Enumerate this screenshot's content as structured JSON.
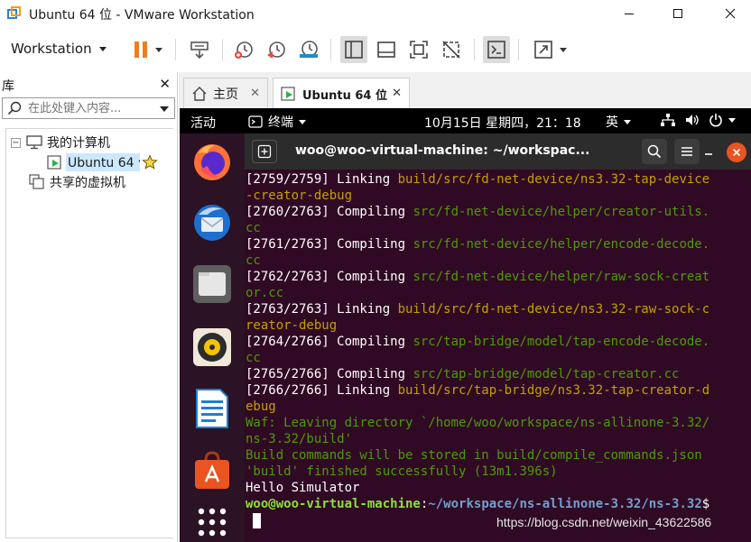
{
  "window": {
    "title": "Ubuntu 64 位 - VMware Workstation"
  },
  "toolbar": {
    "workstation_menu": "Workstation",
    "icons": [
      "pause-icon",
      "send-keys-icon",
      "snapshot-icon",
      "revert-snapshot-icon",
      "snapshot-manager-icon",
      "library-view-icon",
      "console-view-icon",
      "fullscreen-icon",
      "unity-icon",
      "terminal-view-icon",
      "stretch-icon"
    ]
  },
  "library": {
    "title": "库",
    "search_placeholder": "在此处键入内容...",
    "tree": {
      "my_computer": "我的计算机",
      "vm": "Ubuntu 64 位",
      "shared": "共享的虚拟机"
    }
  },
  "tabs": [
    {
      "label": "主页",
      "active": false
    },
    {
      "label": "Ubuntu 64 位",
      "active": true
    }
  ],
  "guest": {
    "topbar": {
      "activities": "活动",
      "app_name": "终端",
      "clock": "10月15日 星期四，21：18",
      "input_method": "英"
    },
    "dock_apps": [
      "firefox-icon",
      "thunderbird-icon",
      "files-icon",
      "rhythmbox-icon",
      "libreoffice-writer-icon",
      "software-center-icon",
      "show-apps-icon"
    ],
    "terminal": {
      "title": "woo@woo-virtual-machine: ~/workspac...",
      "lines": [
        [
          {
            "t": "[2759/2759] Linking ",
            "c": "white"
          },
          {
            "t": "build/src/fd-net-device/ns3.32-tap-device",
            "c": "orange"
          }
        ],
        [
          {
            "t": "-creator-debug",
            "c": "orange"
          }
        ],
        [
          {
            "t": "[2760/2763] Compiling ",
            "c": "white"
          },
          {
            "t": "src/fd-net-device/helper/creator-utils.",
            "c": "green"
          }
        ],
        [
          {
            "t": "cc",
            "c": "green"
          }
        ],
        [
          {
            "t": "[2761/2763] Compiling ",
            "c": "white"
          },
          {
            "t": "src/fd-net-device/helper/encode-decode.",
            "c": "green"
          }
        ],
        [
          {
            "t": "cc",
            "c": "green"
          }
        ],
        [
          {
            "t": "[2762/2763] Compiling ",
            "c": "white"
          },
          {
            "t": "src/fd-net-device/helper/raw-sock-creat",
            "c": "green"
          }
        ],
        [
          {
            "t": "or.cc",
            "c": "green"
          }
        ],
        [
          {
            "t": "[2763/2763] Linking ",
            "c": "white"
          },
          {
            "t": "build/src/fd-net-device/ns3.32-raw-sock-c",
            "c": "orange"
          }
        ],
        [
          {
            "t": "reator-debug",
            "c": "orange"
          }
        ],
        [
          {
            "t": "[2764/2766] Compiling ",
            "c": "white"
          },
          {
            "t": "src/tap-bridge/model/tap-encode-decode.",
            "c": "green"
          }
        ],
        [
          {
            "t": "cc",
            "c": "green"
          }
        ],
        [
          {
            "t": "[2765/2766] Compiling ",
            "c": "white"
          },
          {
            "t": "src/tap-bridge/model/tap-creator.cc",
            "c": "green"
          }
        ],
        [
          {
            "t": "[2766/2766] Linking ",
            "c": "white"
          },
          {
            "t": "build/src/tap-bridge/ns3.32-tap-creator-d",
            "c": "orange"
          }
        ],
        [
          {
            "t": "ebug",
            "c": "orange"
          }
        ],
        [
          {
            "t": "Waf: Leaving directory `/home/woo/workspace/ns-allinone-3.32/",
            "c": "green"
          }
        ],
        [
          {
            "t": "ns-3.32/build'",
            "c": "green"
          }
        ],
        [
          {
            "t": "Build commands will be stored in build/compile_commands.json",
            "c": "green"
          }
        ],
        [
          {
            "t": "'build' finished successfully (13m1.396s)",
            "c": "green"
          }
        ],
        [
          {
            "t": "Hello Simulator",
            "c": "white"
          }
        ],
        [
          {
            "t": "woo@woo-virtual-machine",
            "c": "bright-green"
          },
          {
            "t": ":",
            "c": "white"
          },
          {
            "t": "~/workspace/ns-allinone-3.32/ns-3.32",
            "c": "blue"
          },
          {
            "t": "$",
            "c": "white"
          }
        ]
      ]
    },
    "watermark": "https://blog.csdn.net/weixin_43622586"
  }
}
